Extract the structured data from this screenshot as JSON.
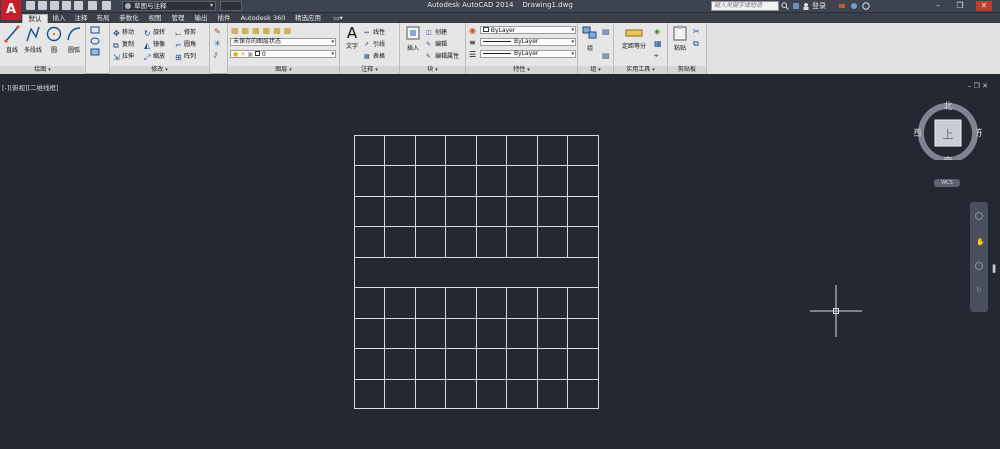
{
  "titlebar": {
    "app_title": "Autodesk AutoCAD 2014",
    "file_name": "Drawing1.dwg",
    "workspace": "草图与注释",
    "search_placeholder": "键入关键字或短语",
    "login": "登录",
    "minimize": "–",
    "restore": "❐",
    "close": "✕"
  },
  "tabs": [
    {
      "label": "默认"
    },
    {
      "label": "插入"
    },
    {
      "label": "注释"
    },
    {
      "label": "布局"
    },
    {
      "label": "参数化"
    },
    {
      "label": "视图"
    },
    {
      "label": "管理"
    },
    {
      "label": "输出"
    },
    {
      "label": "插件"
    },
    {
      "label": "Autodesk 360"
    },
    {
      "label": "精选应用"
    },
    {
      "label": "▭▾"
    }
  ],
  "ribbon": {
    "draw": {
      "label": "绘图",
      "line": "直线",
      "polyline": "多段线",
      "circle": "圆",
      "arc": "圆弧"
    },
    "modify": {
      "label": "修改",
      "move": "移动",
      "rotate": "旋转",
      "trim": "修剪",
      "copy": "复制",
      "mirror": "镜像",
      "fillet": "圆角",
      "stretch": "拉伸",
      "scale": "缩放",
      "array": "阵列"
    },
    "layers": {
      "label": "图层",
      "layer_state": "未保存的图层状态",
      "current_layer": "0"
    },
    "annotation": {
      "label": "注释",
      "text": "文字",
      "linear": "线性",
      "leader": "引线",
      "table": "表格"
    },
    "block": {
      "label": "块",
      "insert": "插入",
      "create": "创建",
      "edit": "编辑",
      "edit_attr": "编辑属性"
    },
    "properties": {
      "label": "特性",
      "color": "ByLayer",
      "linetype": "ByLayer",
      "lineweight": "ByLayer"
    },
    "groups": {
      "label": "组",
      "group": "组"
    },
    "utilities": {
      "label": "实用工具",
      "measure": "测量",
      "divide": "定距等分"
    },
    "clipboard": {
      "label": "剪贴板",
      "paste": "粘贴"
    }
  },
  "viewport": {
    "label": "[-][俯视][二维线框]",
    "controls": "–  ❐  ✕"
  },
  "viewcube": {
    "north": "北",
    "south": "南",
    "east": "东",
    "west": "西",
    "face": "上",
    "wcs": "WCS"
  },
  "colors": {
    "canvas": "#232833",
    "grid_line": "#d9dbe0",
    "ribbon": "#e6e6e6",
    "title_bar": "#3d4450",
    "logo": "#c8202a"
  }
}
